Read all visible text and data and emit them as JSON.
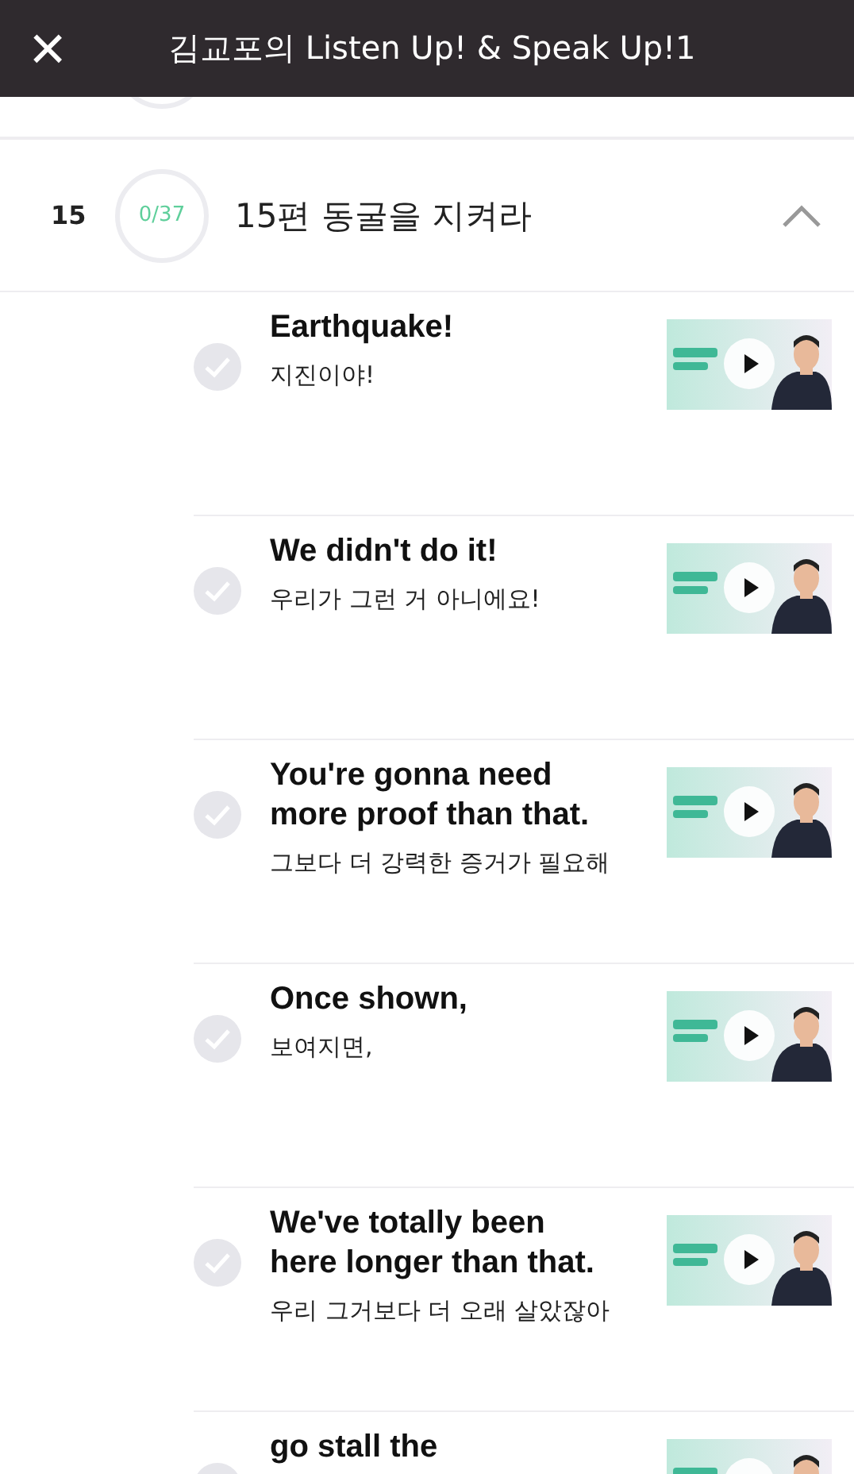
{
  "header": {
    "close_icon": "×",
    "title": "김교포의 Listen Up! & Speak Up!1"
  },
  "section": {
    "number": "15",
    "progress": "0/37",
    "title": "15편 동굴을 지켜라",
    "expanded": true
  },
  "items": [
    {
      "english": "Earthquake!",
      "korean": "지진이야!",
      "done": false
    },
    {
      "english": "We didn't do it!",
      "korean": "우리가 그런 거 아니에요!",
      "done": false
    },
    {
      "english": "You're gonna need more proof than that.",
      "korean": "그보다 더 강력한 증거가 필요해",
      "done": false
    },
    {
      "english": "Once shown,",
      "korean": "보여지면,",
      "done": false
    },
    {
      "english": "We've totally been here longer than that.",
      "korean": "우리 그거보다 더 오래 살았잖아",
      "done": false
    },
    {
      "english": "go stall the",
      "done": false
    }
  ]
}
